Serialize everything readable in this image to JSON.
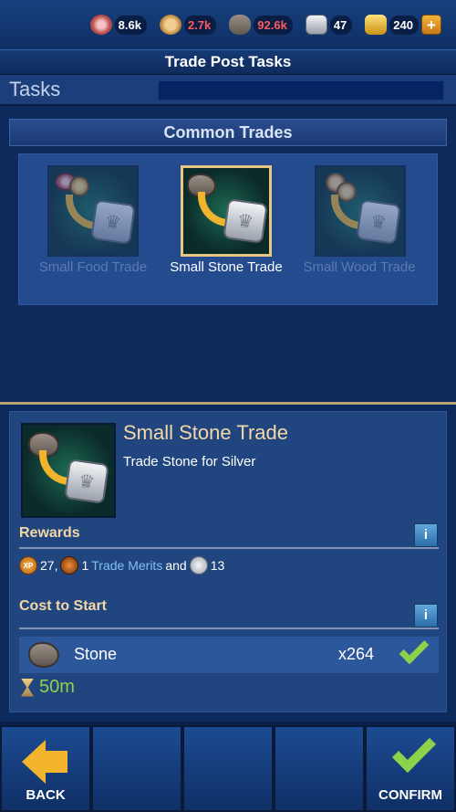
{
  "resources": [
    {
      "icon": "food-icon",
      "value": "8.6k",
      "color": "#ffffff"
    },
    {
      "icon": "wood-icon",
      "value": "2.7k",
      "color": "#ff5a5a"
    },
    {
      "icon": "stone-icon",
      "value": "92.6k",
      "color": "#ff5a5a"
    },
    {
      "icon": "silver-icon",
      "value": "47",
      "color": "#ffffff"
    },
    {
      "icon": "gold-icon",
      "value": "240",
      "color": "#ffffff"
    }
  ],
  "header": {
    "title": "Trade Post Tasks"
  },
  "tasks": {
    "label": "Tasks"
  },
  "section": {
    "title": "Common Trades"
  },
  "trades": [
    {
      "label": "Small Food Trade",
      "state": "dimmed"
    },
    {
      "label": "Small Stone Trade",
      "state": "selected"
    },
    {
      "label": "Small Wood Trade",
      "state": "dimmed"
    }
  ],
  "detail": {
    "title": "Small Stone Trade",
    "description": "Trade Stone for Silver",
    "rewards_heading": "Rewards",
    "rewards": {
      "xp_label": "XP",
      "xp_value": "27,",
      "merits_value": "1",
      "merits_name": "Trade Merits",
      "and_text": "and",
      "silver_value": "13"
    },
    "cost_heading": "Cost to Start",
    "cost": {
      "name": "Stone",
      "quantity": "x264"
    },
    "duration": "50m",
    "info_label": "i"
  },
  "bottom": {
    "back_label": "BACK",
    "confirm_label": "CONFIRM"
  },
  "colors": {
    "accent_gold": "#f4d7a6",
    "check_green": "#8ed14a",
    "panel_blue": "#21467f"
  }
}
